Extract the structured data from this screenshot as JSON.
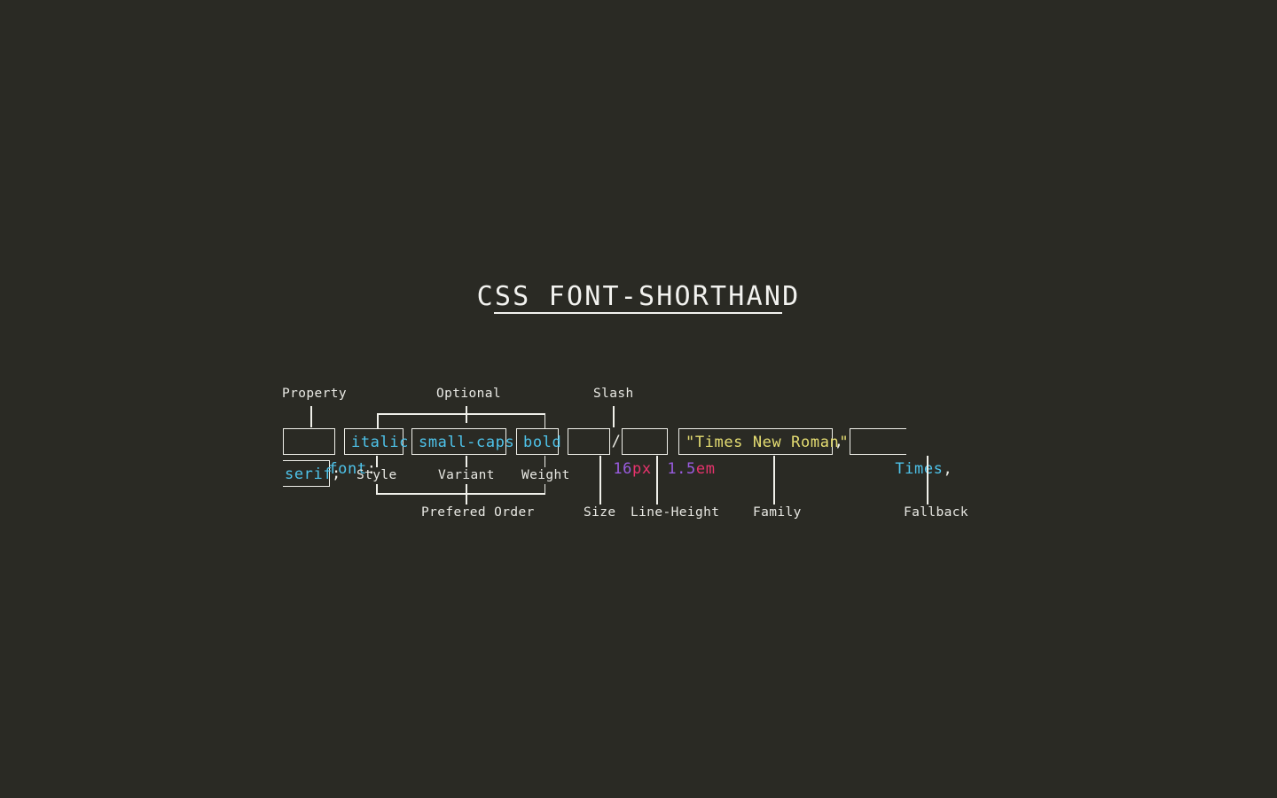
{
  "page": {
    "title": "CSS FONT-SHORTHAND",
    "background_color": "#2a2a24",
    "foreground_color": "#f0f0ea"
  },
  "palette": {
    "keyword": "#4ec3ea",
    "number": "#9a5ce0",
    "unit": "#e8336d",
    "string": "#e5dd72",
    "punctuation": "#eeeee8",
    "line": "#f0f0ea"
  },
  "code": {
    "full_declaration": "font: italic small-caps bold 16px/1.5em \"Times New Roman\", Times, serif;",
    "tokens": [
      {
        "id": "property",
        "text": "font:",
        "boxed": true,
        "color_role": "keyword"
      },
      {
        "id": "style",
        "text": "italic",
        "boxed": true,
        "color_role": "keyword"
      },
      {
        "id": "variant",
        "text": "small-caps",
        "boxed": true,
        "color_role": "keyword"
      },
      {
        "id": "weight",
        "text": "bold",
        "boxed": true,
        "color_role": "keyword"
      },
      {
        "id": "size",
        "text": "16px",
        "boxed": true,
        "color_role": "number+unit"
      },
      {
        "id": "slash",
        "text": "/",
        "boxed": false,
        "color_role": "punctuation"
      },
      {
        "id": "line-height",
        "text": "1.5em",
        "boxed": true,
        "color_role": "number+unit"
      },
      {
        "id": "family",
        "text": "\"Times New Roman\"",
        "boxed": true,
        "color_role": "string"
      },
      {
        "id": "comma-1",
        "text": ",",
        "boxed": false,
        "color_role": "punctuation"
      },
      {
        "id": "fallback-a",
        "text": "Times",
        "boxed": true,
        "color_role": "keyword"
      },
      {
        "id": "comma-2",
        "text": ",",
        "boxed": false,
        "color_role": "punctuation"
      },
      {
        "id": "fallback-b",
        "text": "serif",
        "boxed": true,
        "color_role": "keyword"
      },
      {
        "id": "semicolon",
        "text": ";",
        "boxed": false,
        "color_role": "punctuation"
      }
    ],
    "token_text": {
      "property_name": "font",
      "property_colon": ":",
      "style": "italic",
      "variant": "small-caps",
      "weight": "bold",
      "size_number": "16",
      "size_unit": "px",
      "slash": "/",
      "line_height_number": "1.5",
      "line_height_unit": "em",
      "family": "\"Times New Roman\"",
      "comma_after_family": ",",
      "fallback_times": "Times",
      "comma_after_times": ",",
      "fallback_serif": "serif",
      "semicolon": ";"
    }
  },
  "annotations": {
    "above": [
      {
        "id": "property",
        "label": "Property"
      },
      {
        "id": "optional",
        "label": "Optional"
      },
      {
        "id": "slash",
        "label": "Slash"
      }
    ],
    "middle": [
      {
        "id": "style",
        "label": "Style"
      },
      {
        "id": "variant",
        "label": "Variant"
      },
      {
        "id": "weight",
        "label": "Weight"
      }
    ],
    "below": [
      {
        "id": "prefered-order",
        "label": "Prefered Order"
      },
      {
        "id": "size",
        "label": "Size"
      },
      {
        "id": "line-height",
        "label": "Line-Height"
      },
      {
        "id": "family",
        "label": "Family"
      },
      {
        "id": "fallback",
        "label": "Fallback"
      }
    ]
  }
}
